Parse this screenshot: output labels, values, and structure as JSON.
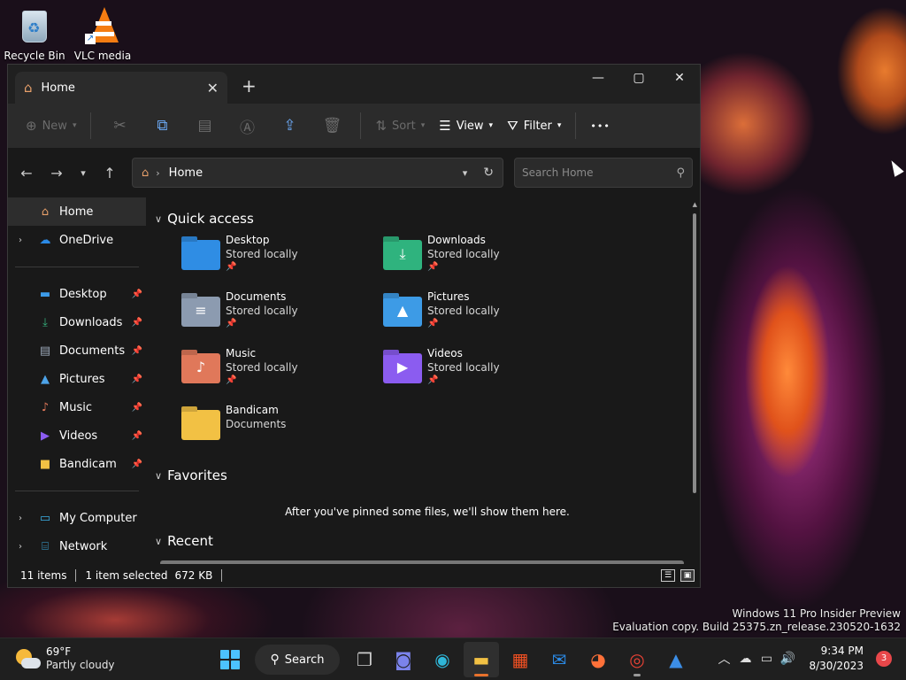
{
  "desktop": {
    "icons": [
      {
        "label": "Recycle Bin",
        "icon": "recycle-bin-icon"
      },
      {
        "label": "VLC media",
        "icon": "vlc-icon"
      }
    ],
    "watermark": {
      "line1": "Windows 11 Pro Insider Preview",
      "line2": "Evaluation copy. Build 25375.zn_release.230520-1632"
    }
  },
  "window": {
    "tab_title": "Home",
    "caption": {
      "minimize": "—",
      "maximize": "▢",
      "close": "✕"
    },
    "toolbar": {
      "new_label": "New",
      "sort_label": "Sort",
      "view_label": "View",
      "filter_label": "Filter",
      "more_label": "•••"
    },
    "address": {
      "breadcrumb": "Home"
    },
    "search": {
      "placeholder": "Search Home"
    },
    "sidebar": {
      "items": [
        {
          "label": "Home",
          "icon": "home-icon",
          "color": "#e8a06a"
        },
        {
          "label": "OneDrive",
          "icon": "cloud-icon",
          "color": "#2b8ae6"
        }
      ],
      "pinned": [
        {
          "label": "Desktop",
          "icon": "desktop-folder-icon",
          "color": "#3c9be8"
        },
        {
          "label": "Downloads",
          "icon": "download-icon",
          "color": "#36b37e"
        },
        {
          "label": "Documents",
          "icon": "document-icon",
          "color": "#9aa7b8"
        },
        {
          "label": "Pictures",
          "icon": "picture-icon",
          "color": "#4da3e8"
        },
        {
          "label": "Music",
          "icon": "music-icon",
          "color": "#e0785a"
        },
        {
          "label": "Videos",
          "icon": "video-icon",
          "color": "#8b5cf0"
        },
        {
          "label": "Bandicam",
          "icon": "folder-icon",
          "color": "#f2c144"
        }
      ],
      "bottom": [
        {
          "label": "My Computer",
          "icon": "computer-icon",
          "color": "#3cb0e6"
        },
        {
          "label": "Network",
          "icon": "network-icon",
          "color": "#3cb0e6"
        }
      ]
    },
    "quick_access": {
      "title": "Quick access",
      "items": [
        {
          "name": "Desktop",
          "sub": "Stored locally",
          "pinned": true,
          "color": "#2f8de4",
          "glyph": ""
        },
        {
          "name": "Downloads",
          "sub": "Stored locally",
          "pinned": true,
          "color": "#2fb37e",
          "glyph": "⤓"
        },
        {
          "name": "Documents",
          "sub": "Stored locally",
          "pinned": true,
          "color": "#8c9bb0",
          "glyph": "≡"
        },
        {
          "name": "Pictures",
          "sub": "Stored locally",
          "pinned": true,
          "color": "#3d9be6",
          "glyph": "▲"
        },
        {
          "name": "Music",
          "sub": "Stored locally",
          "pinned": true,
          "color": "#e0785a",
          "glyph": "♪"
        },
        {
          "name": "Videos",
          "sub": "Stored locally",
          "pinned": true,
          "color": "#8b5cf0",
          "glyph": "▶"
        },
        {
          "name": "Bandicam",
          "sub": "Documents",
          "pinned": false,
          "color": "#f2c144",
          "glyph": ""
        }
      ]
    },
    "favorites": {
      "title": "Favorites",
      "empty_message": "After you've pinned some files, we'll show them here."
    },
    "recent": {
      "title": "Recent"
    },
    "status": {
      "items_count": "11 items",
      "selection": "1 item selected",
      "size": "672 KB"
    }
  },
  "taskbar": {
    "weather": {
      "temp": "69°F",
      "desc": "Partly cloudy"
    },
    "search_label": "Search",
    "apps": [
      {
        "name": "task-view-icon",
        "glyph": "❐"
      },
      {
        "name": "teams-chat-icon",
        "glyph": "◙"
      },
      {
        "name": "edge-icon",
        "glyph": "◉"
      },
      {
        "name": "file-explorer-icon",
        "glyph": "▬"
      },
      {
        "name": "store-icon",
        "glyph": "▦"
      },
      {
        "name": "mail-icon",
        "glyph": "✉"
      },
      {
        "name": "firefox-icon",
        "glyph": "◕"
      },
      {
        "name": "chrome-icon",
        "glyph": "◎"
      },
      {
        "name": "app-icon",
        "glyph": "▲"
      }
    ],
    "clock": {
      "time": "9:34 PM",
      "date": "8/30/2023"
    },
    "notification_count": "3"
  }
}
